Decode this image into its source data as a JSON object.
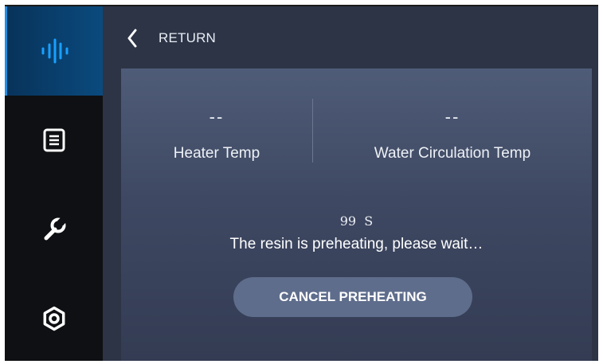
{
  "sidebar": {
    "items": [
      {
        "icon": "waveform-icon",
        "active": true
      },
      {
        "icon": "list-document-icon",
        "active": false
      },
      {
        "icon": "wrench-icon",
        "active": false
      },
      {
        "icon": "gear-icon",
        "active": false
      }
    ]
  },
  "header": {
    "return_label": "RETURN"
  },
  "temps": {
    "heater": {
      "value": "--",
      "label": "Heater Temp"
    },
    "water": {
      "value": "--",
      "label": "Water Circulation Temp"
    }
  },
  "preheat": {
    "countdown": "99  S",
    "message": "The resin is preheating, please wait…",
    "cancel_label": "CANCEL PREHEATING"
  },
  "colors": {
    "accent": "#1f8fe6",
    "background": "#2c3446",
    "sidebar": "#0f1013",
    "button": "#5f6d8c"
  }
}
